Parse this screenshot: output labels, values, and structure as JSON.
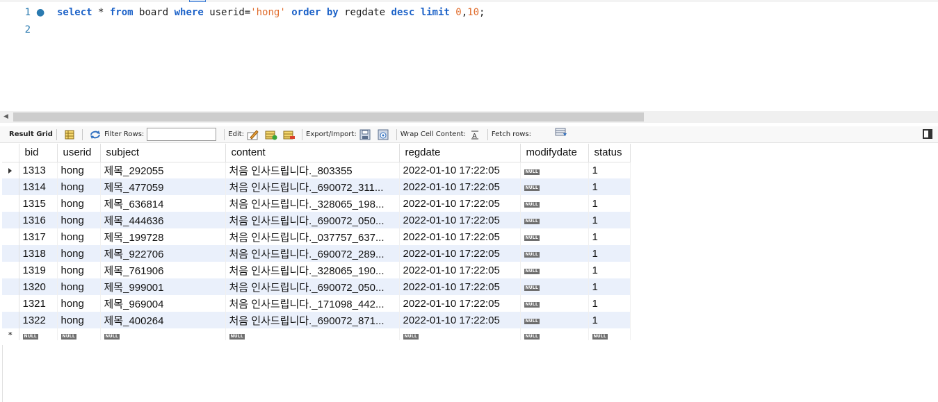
{
  "editor": {
    "lines": [
      {
        "number": "1",
        "has_marker": true
      },
      {
        "number": "2",
        "has_marker": false
      }
    ],
    "query_tokens": [
      {
        "t": "select",
        "k": "kw"
      },
      {
        "t": " * ",
        "k": "plain"
      },
      {
        "t": "from",
        "k": "kw"
      },
      {
        "t": " board ",
        "k": "plain"
      },
      {
        "t": "where",
        "k": "kw"
      },
      {
        "t": " userid=",
        "k": "plain"
      },
      {
        "t": "'hong'",
        "k": "str"
      },
      {
        "t": " ",
        "k": "plain"
      },
      {
        "t": "order",
        "k": "kw"
      },
      {
        "t": " ",
        "k": "plain"
      },
      {
        "t": "by",
        "k": "kw"
      },
      {
        "t": " regdate ",
        "k": "plain"
      },
      {
        "t": "desc",
        "k": "kw"
      },
      {
        "t": " ",
        "k": "plain"
      },
      {
        "t": "limit",
        "k": "kw"
      },
      {
        "t": " ",
        "k": "plain"
      },
      {
        "t": "0",
        "k": "num"
      },
      {
        "t": ",",
        "k": "plain"
      },
      {
        "t": "10",
        "k": "num"
      },
      {
        "t": ";",
        "k": "plain"
      }
    ]
  },
  "toolbar": {
    "result_grid_label": "Result Grid",
    "filter_rows_label": "Filter Rows:",
    "filter_rows_value": "",
    "edit_label": "Edit:",
    "export_import_label": "Export/Import:",
    "wrap_cell_label": "Wrap Cell Content:",
    "fetch_rows_label": "Fetch rows:"
  },
  "grid": {
    "columns": [
      "bid",
      "userid",
      "subject",
      "content",
      "regdate",
      "modifydate",
      "status"
    ],
    "null_label": "NULL",
    "rows": [
      {
        "bid": "1313",
        "userid": "hong",
        "subject": "제목_292055",
        "content": "처음 인사드립니다._803355",
        "regdate": "2022-01-10 17:22:05",
        "status": "1"
      },
      {
        "bid": "1314",
        "userid": "hong",
        "subject": "제목_477059",
        "content": "처음 인사드립니다._690072_311...",
        "regdate": "2022-01-10 17:22:05",
        "status": "1"
      },
      {
        "bid": "1315",
        "userid": "hong",
        "subject": "제목_636814",
        "content": "처음 인사드립니다._328065_198...",
        "regdate": "2022-01-10 17:22:05",
        "status": "1"
      },
      {
        "bid": "1316",
        "userid": "hong",
        "subject": "제목_444636",
        "content": "처음 인사드립니다._690072_050...",
        "regdate": "2022-01-10 17:22:05",
        "status": "1"
      },
      {
        "bid": "1317",
        "userid": "hong",
        "subject": "제목_199728",
        "content": "처음 인사드립니다._037757_637...",
        "regdate": "2022-01-10 17:22:05",
        "status": "1"
      },
      {
        "bid": "1318",
        "userid": "hong",
        "subject": "제목_922706",
        "content": "처음 인사드립니다._690072_289...",
        "regdate": "2022-01-10 17:22:05",
        "status": "1"
      },
      {
        "bid": "1319",
        "userid": "hong",
        "subject": "제목_761906",
        "content": "처음 인사드립니다._328065_190...",
        "regdate": "2022-01-10 17:22:05",
        "status": "1"
      },
      {
        "bid": "1320",
        "userid": "hong",
        "subject": "제목_999001",
        "content": "처음 인사드립니다._690072_050...",
        "regdate": "2022-01-10 17:22:05",
        "status": "1"
      },
      {
        "bid": "1321",
        "userid": "hong",
        "subject": "제목_969004",
        "content": "처음 인사드립니다._171098_442...",
        "regdate": "2022-01-10 17:22:05",
        "status": "1"
      },
      {
        "bid": "1322",
        "userid": "hong",
        "subject": "제목_400264",
        "content": "처음 인사드립니다._690072_871...",
        "regdate": "2022-01-10 17:22:05",
        "status": "1"
      }
    ],
    "new_row_marker": "*"
  }
}
